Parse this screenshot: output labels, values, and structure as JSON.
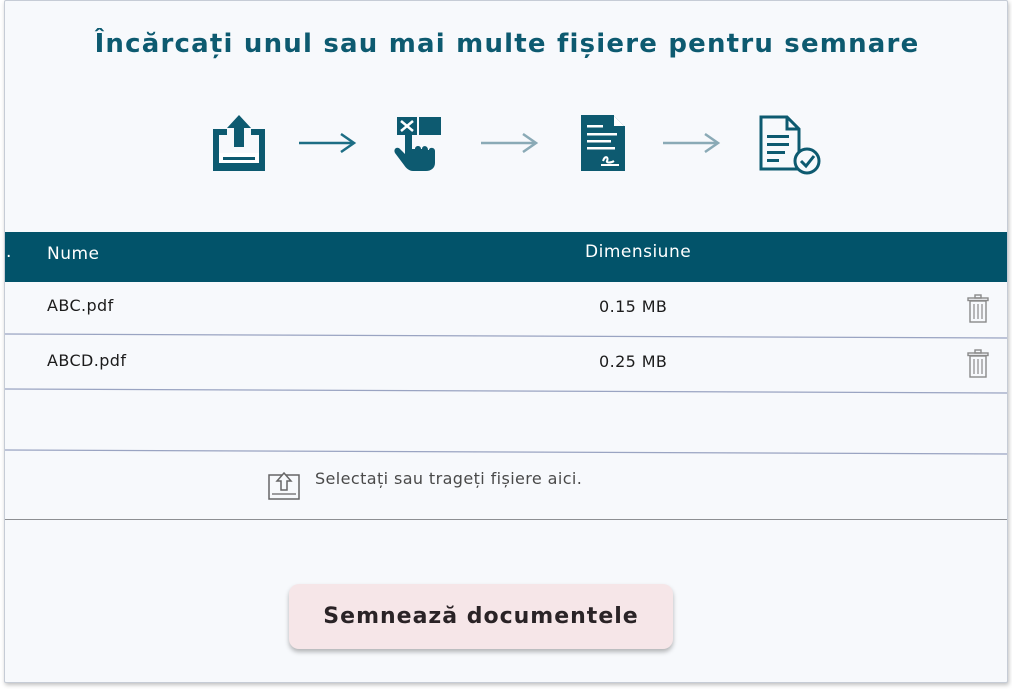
{
  "header": {
    "title": "Încărcați unul sau mai multe fișiere pentru semnare"
  },
  "steps": [
    {
      "icon": "upload-icon"
    },
    {
      "icon": "select-touch-icon"
    },
    {
      "icon": "document-sign-icon"
    },
    {
      "icon": "document-verified-icon"
    }
  ],
  "table": {
    "columns": {
      "index": ".",
      "name": "Nume",
      "size": "Dimensiune"
    },
    "rows": [
      {
        "name": "ABC.pdf",
        "size": "0.15 MB",
        "delete_icon": "trash-icon"
      },
      {
        "name": "ABCD.pdf",
        "size": "0.25 MB",
        "delete_icon": "trash-icon"
      }
    ]
  },
  "dropzone": {
    "icon": "upload-small-icon",
    "text": "Selectați sau trageți fișiere aici."
  },
  "actions": {
    "sign_label": "Semnează documentele"
  },
  "colors": {
    "accent": "#02536a",
    "title": "#0d5a70",
    "background": "#f7f9fc",
    "button_bg": "#f6e6e8"
  }
}
